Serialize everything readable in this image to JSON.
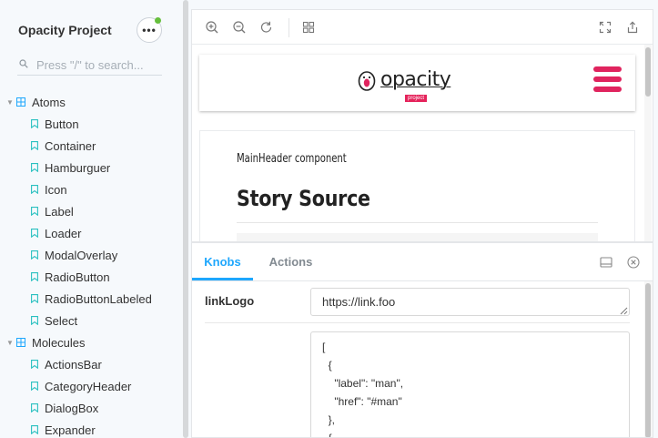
{
  "sidebar": {
    "title": "Opacity Project",
    "menu_label": "•••",
    "search_placeholder": "Press \"/\" to search...",
    "groups": [
      {
        "label": "Atoms",
        "items": [
          {
            "label": "Button"
          },
          {
            "label": "Container"
          },
          {
            "label": "Hamburguer"
          },
          {
            "label": "Icon"
          },
          {
            "label": "Label"
          },
          {
            "label": "Loader"
          },
          {
            "label": "ModalOverlay"
          },
          {
            "label": "RadioButton"
          },
          {
            "label": "RadioButtonLabeled"
          },
          {
            "label": "Select"
          }
        ]
      },
      {
        "label": "Molecules",
        "items": [
          {
            "label": "ActionsBar"
          },
          {
            "label": "CategoryHeader"
          },
          {
            "label": "DialogBox"
          },
          {
            "label": "Expander"
          }
        ]
      }
    ]
  },
  "toolbar": {
    "icons": [
      "zoom-in-icon",
      "zoom-out-icon",
      "reset-zoom-icon",
      "grid-icon",
      "fullscreen-icon",
      "share-icon"
    ]
  },
  "preview": {
    "logo_text": "opacity",
    "logo_sub": "project",
    "docs_heading": "MainHeader component",
    "docs_title": "Story Source"
  },
  "panel": {
    "tabs": [
      {
        "label": "Knobs",
        "active": true
      },
      {
        "label": "Actions",
        "active": false
      }
    ],
    "knobs": [
      {
        "label": "linkLogo",
        "value": "https://link.foo"
      },
      {
        "label": "",
        "value": "[\n  {\n    \"label\": \"man\",\n    \"href\": \"#man\"\n  },\n  {"
      }
    ]
  },
  "colors": {
    "accent": "#1ea7fd",
    "brand": "#e0245e",
    "sidebar_bg": "#f6f9fc",
    "icon_teal": "#2ac0c0",
    "status_dot": "#66bf3c"
  }
}
